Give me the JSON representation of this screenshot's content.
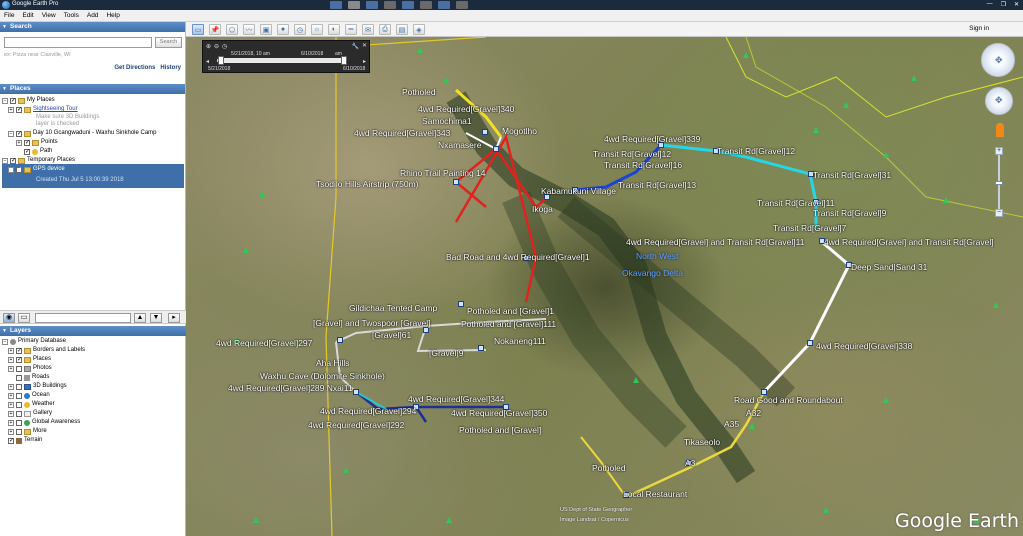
{
  "window": {
    "title": "Google Earth Pro",
    "sign_in": "Sign in"
  },
  "menu": [
    "File",
    "Edit",
    "View",
    "Tools",
    "Add",
    "Help"
  ],
  "search": {
    "header": "Search",
    "input_value": "",
    "button_label": "Search",
    "hint": "ex: Pizza near Claxville, WI",
    "get_directions": "Get Directions",
    "history": "History"
  },
  "places": {
    "header": "Places",
    "items": [
      {
        "label": "My Places"
      },
      {
        "label": "Sightseeing Tour"
      },
      {
        "label": "Make sure 3D Buildings"
      },
      {
        "label": "layer is checked"
      },
      {
        "label": "Day 10 Gcangwaduni - Waxhu Sinkhole Camp"
      },
      {
        "label": "Points"
      },
      {
        "label": "Path"
      },
      {
        "label": "Temporary Places"
      },
      {
        "label": "GPS device"
      },
      {
        "label": "Created Thu Jul 5 13:00:39 2018"
      }
    ]
  },
  "layers": {
    "header": "Layers",
    "items": [
      {
        "label": "Primary Database"
      },
      {
        "label": "Borders and Labels"
      },
      {
        "label": "Places"
      },
      {
        "label": "Photos"
      },
      {
        "label": "Roads"
      },
      {
        "label": "3D Buildings"
      },
      {
        "label": "Ocean"
      },
      {
        "label": "Weather"
      },
      {
        "label": "Gallery"
      },
      {
        "label": "Global Awareness"
      },
      {
        "label": "More"
      },
      {
        "label": "Terrain"
      }
    ]
  },
  "time_slider": {
    "start_top": "5/21/2018, 10 am",
    "end_top": "6/10/2018",
    "end_top_suffix": "am",
    "start_bottom": "5/21/2018",
    "end_bottom": "6/10/2018"
  },
  "map": {
    "watermark": "Google Earth",
    "copyright_1": "US Dept of State Geographer",
    "copyright_2": "Image Landsat / Copernicus",
    "labels": [
      "Potholed",
      "4wd Required[Gravel]340",
      "Samochima1",
      "4wd Required[Gravel]343",
      "Mogotlho",
      "Nxamasere",
      "4wd Required[Gravel]339",
      "Transit Rd[Gravel]12",
      "Transit Rd[Gravel]16",
      "Transit Rd[Gravel]12",
      "Rhino Trail Painting 14",
      "Tsodilo Hills Airstrip (750m)",
      "Kabamukuni Village",
      "Transit Rd[Gravel]13",
      "Transit Rd[Gravel]31",
      "Transit Rd[Gravel]11",
      "Ikoga",
      "Transit Rd[Gravel]9",
      "Transit Rd[Gravel]7",
      "4wd Required[Gravel] and Transit Rd[Gravel]11",
      "4wd Required[Gravel] and Transit Rd[Gravel]",
      "Bad Road and 4wd Required[Gravel]1",
      "Deep Sand|Sand 31",
      "Gildichaa Tented Camp",
      "Potholed and [Gravel]1",
      "[Gravel] and Twospoor [Gravel]",
      "Potholed and [Gravel]111",
      "[Gravel]61",
      "4wd Required[Gravel]297",
      "Nokaneng111",
      "[Gravel]9",
      "Aha Hills",
      "Waxhu Cave (Dolomite Sinkhole)",
      "4wd Required[Gravel]289 Nxai11",
      "4wd Required[Gravel]338",
      "Road Good and Roundabout",
      "A32",
      "4wd Required[Gravel]344",
      "4wd Required[Gravel]294",
      "4wd Required[Gravel]350",
      "4wd Required[Gravel]292",
      "Potholed and [Gravel]",
      "A35",
      "Tikaseolo",
      "A3",
      "Potholed",
      "Local Restaurant"
    ],
    "regions": [
      "North West",
      "Okavango Delta"
    ]
  }
}
